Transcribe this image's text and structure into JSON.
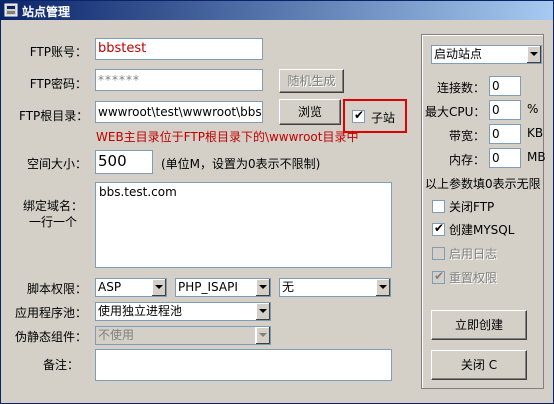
{
  "window": {
    "title": "站点管理"
  },
  "ftp": {
    "account_label": "FTP账号：",
    "account_value": "bbstest",
    "password_label": "FTP密码：",
    "password_value": "******",
    "random_button": "随机生成",
    "root_label": "FTP根目录：",
    "root_value": "wwwroot\\test\\wwwroot\\bbs",
    "browse_button": "浏览",
    "subsite_label": "子站",
    "subsite_checked": true,
    "root_hint": "WEB主目录位于FTP根目录下的\\wwwroot目录中"
  },
  "space": {
    "label": "空间大小：",
    "value": "500",
    "unit_note": "(单位M，设置为0表示不限制)"
  },
  "domain": {
    "label_line1": "绑定域名：",
    "label_line2": "一行一个",
    "value": "bbs.test.com"
  },
  "script": {
    "label": "脚本权限：",
    "option1": "ASP",
    "option2": "PHP_ISAPI",
    "option3": "无"
  },
  "app_pool": {
    "label": "应用程序池：",
    "value": "使用独立进程池"
  },
  "rewrite": {
    "label": "伪静态组件：",
    "value": "不使用"
  },
  "note": {
    "label": "备注：",
    "value": ""
  },
  "right": {
    "site_status": "启动站点",
    "connections_label": "连接数：",
    "connections_value": "0",
    "cpu_label": "最大CPU：",
    "cpu_value": "0",
    "cpu_unit": "%",
    "bandwidth_label": "带宽：",
    "bandwidth_value": "0",
    "bandwidth_unit": "KB",
    "memory_label": "内存：",
    "memory_value": "0",
    "memory_unit": "MB",
    "zero_note": "以上参数填0表示无限",
    "close_ftp": "关闭FTP",
    "close_ftp_checked": false,
    "create_mysql": "创建MYSQL",
    "create_mysql_checked": true,
    "enable_log": "启用日志",
    "enable_log_checked": false,
    "reset_perm": "重置权限",
    "reset_perm_checked": true,
    "create_button": "立即创建",
    "close_button": "关闭 C"
  },
  "colors": {
    "title_bar": "#0a246a",
    "highlight_box": "#e00000",
    "hint_text": "#c00000"
  }
}
